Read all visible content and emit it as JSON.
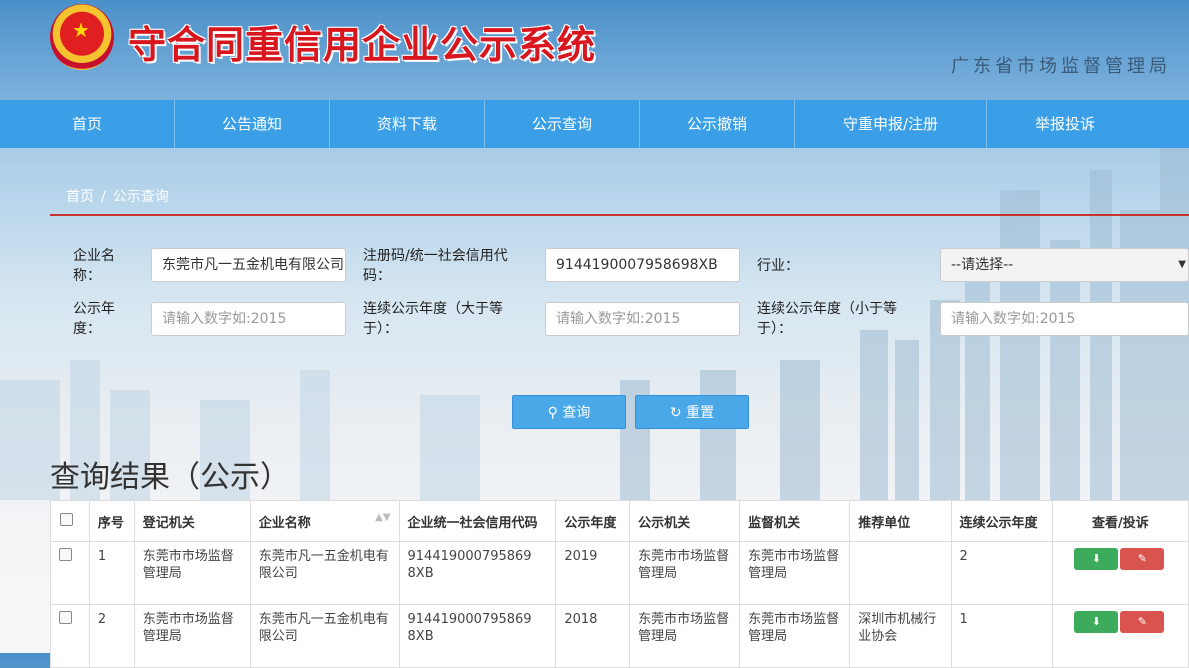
{
  "header": {
    "site_title": "守合同重信用企业公示系统",
    "agency": "广东省市场监督管理局"
  },
  "nav": {
    "items": [
      {
        "label": "首页"
      },
      {
        "label": "公告通知"
      },
      {
        "label": "资料下载"
      },
      {
        "label": "公示查询"
      },
      {
        "label": "公示撤销"
      },
      {
        "label": "守重申报/注册"
      },
      {
        "label": "举报投诉"
      }
    ]
  },
  "breadcrumb": {
    "home": "首页",
    "separator": "/",
    "current": "公示查询"
  },
  "form": {
    "company_name_label_1": "企业名",
    "company_name_label_2": "称：",
    "company_name_value": "东莞市凡一五金机电有限公司",
    "credit_code_label_1": "注册码/统一社会信用代",
    "credit_code_label_2": "码：",
    "credit_code_value": "914419000795869​8XB",
    "industry_label": "行业：",
    "industry_selected": "--请选择--",
    "year_label_1": "公示年",
    "year_label_2": "度：",
    "year_placeholder": "请输入数字如:2015",
    "years_gte_label_1": "连续公示年度（大于等",
    "years_gte_label_2": "于）：",
    "years_gte_placeholder": "请输入数字如:2015",
    "years_lte_label_1": "连续公示年度（小于等",
    "years_lte_label_2": "于）：",
    "years_lte_placeholder": "请输入数字如:2015",
    "search_label": "查询",
    "reset_label": "重置"
  },
  "results": {
    "title": "查询结果（公示）",
    "columns": [
      "序号",
      "登记机关",
      "企业名称",
      "企业统一社会信用代码",
      "公示年度",
      "公示机关",
      "监督机关",
      "推荐单位",
      "连续公示年度",
      "查看/投诉"
    ],
    "rows": [
      {
        "no": "1",
        "reg": "东莞市市场监督管理局",
        "name": "东莞市凡一五金机电有限公司",
        "code": "914419000795869​8XB",
        "year": "2019",
        "pub": "东莞市市场监督管理局",
        "sup": "东莞市市场监督管理局",
        "rec": "",
        "cont": "2"
      },
      {
        "no": "2",
        "reg": "东莞市市场监督管理局",
        "name": "东莞市凡一五金机电有限公司",
        "code": "914419000795869​8XB",
        "year": "2018",
        "pub": "东莞市市场监督管理局",
        "sup": "东莞市市场监督管理局",
        "rec": "深圳市机械行业协会",
        "cont": "1"
      }
    ]
  },
  "icons": {
    "search": "search-icon",
    "reset": "refresh-icon",
    "view": "download-icon",
    "edit": "edit-icon",
    "sort": "sort-icon"
  }
}
